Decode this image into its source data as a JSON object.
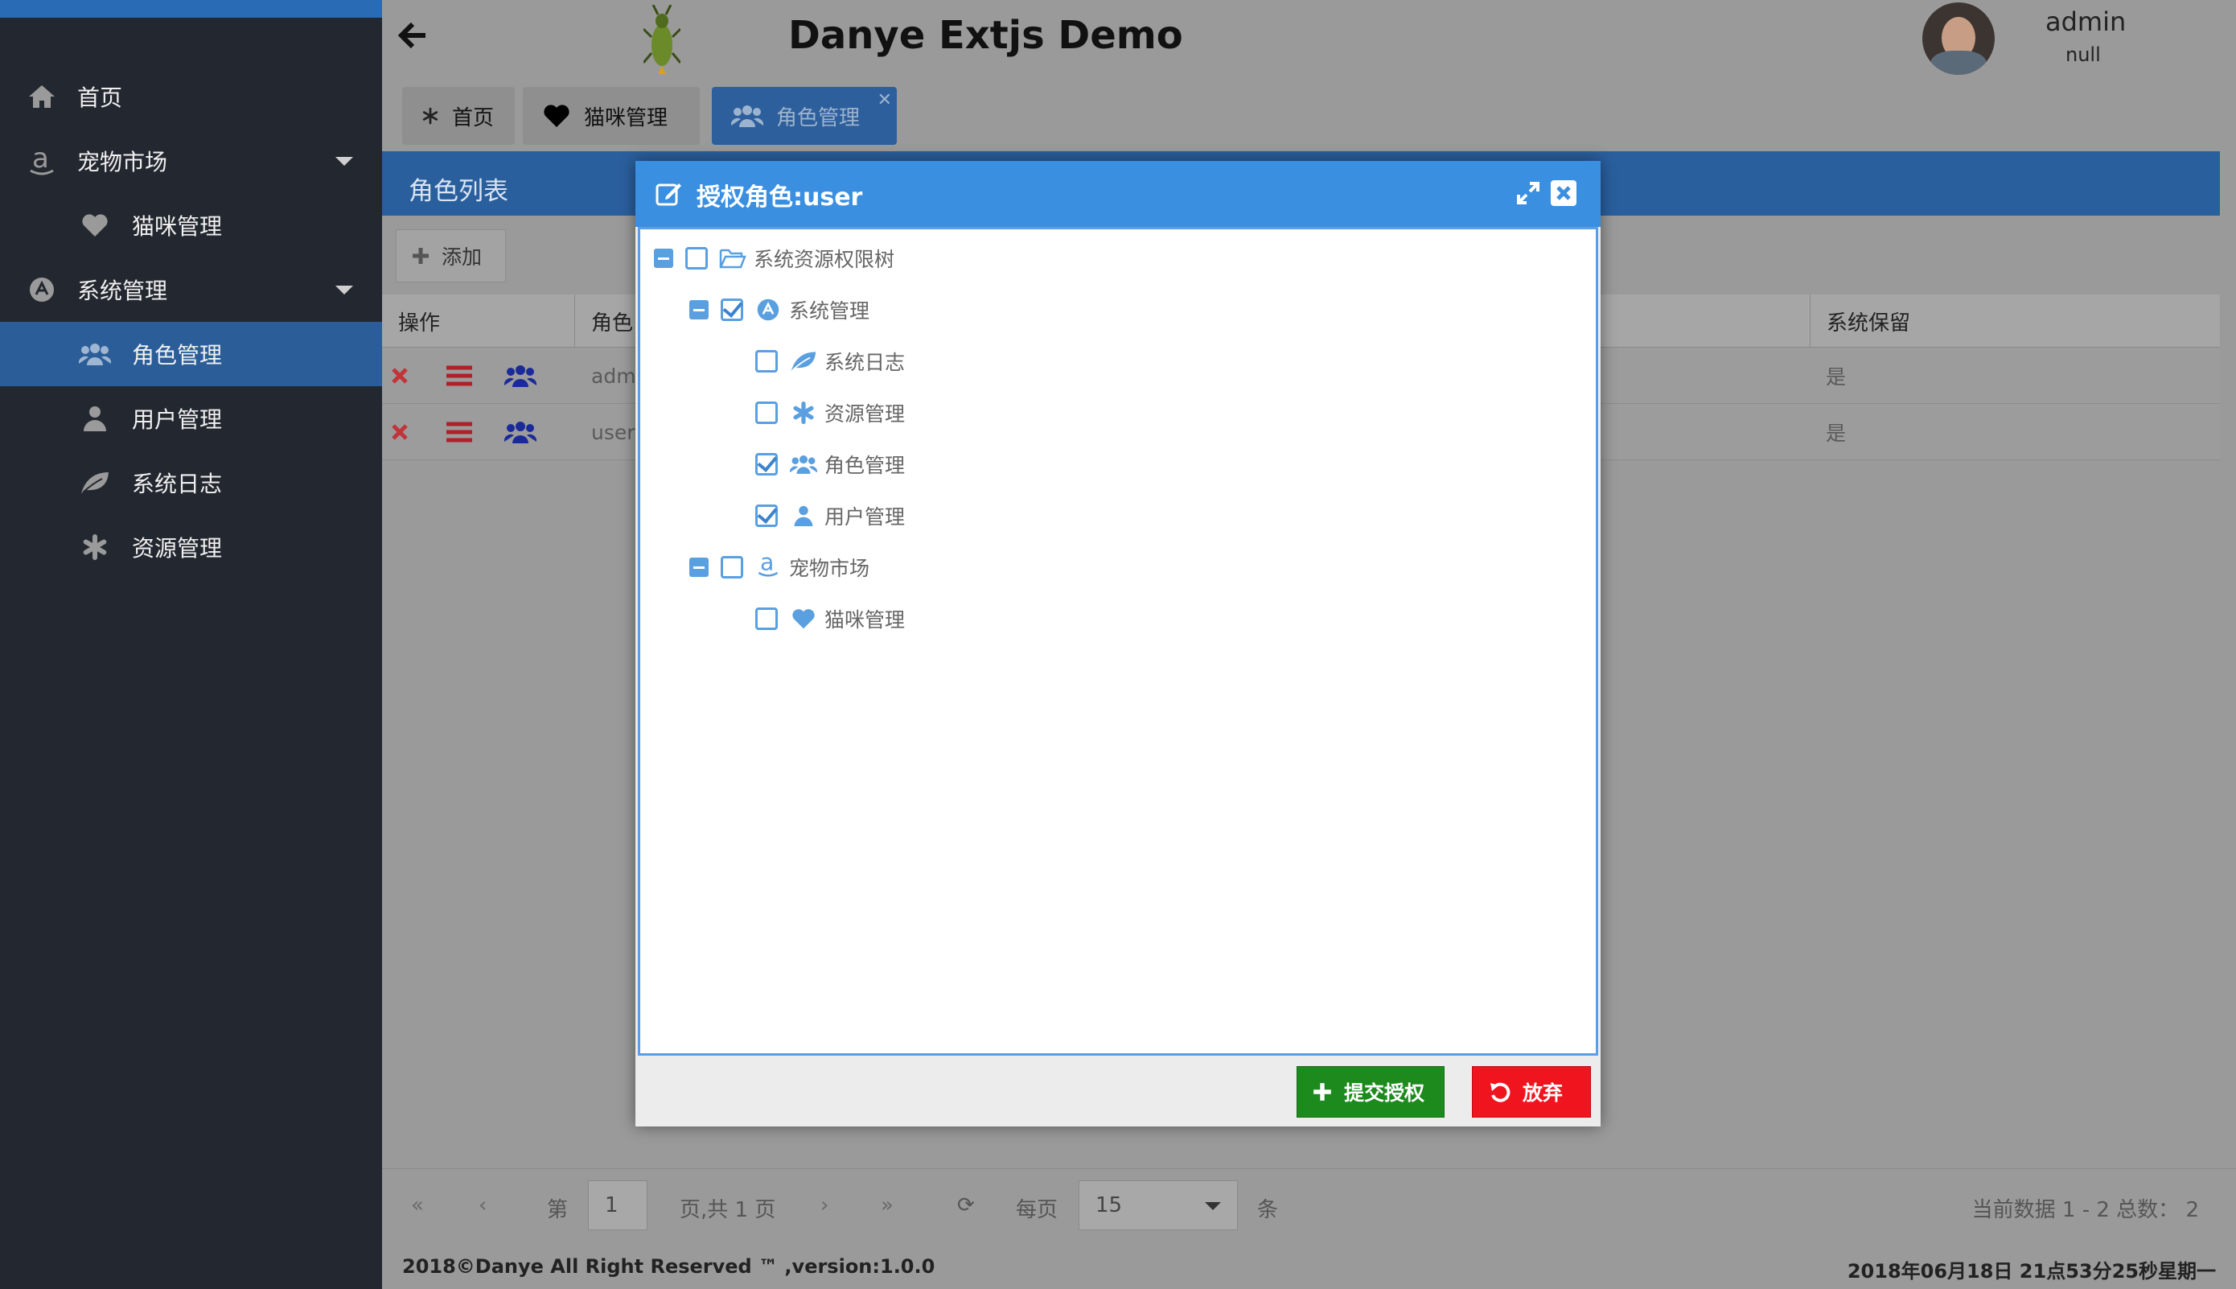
{
  "app": {
    "title": "Danye Extjs Demo",
    "user": {
      "name": "admin",
      "subtitle": "null"
    }
  },
  "sidebar": {
    "items": [
      {
        "label": "首页",
        "icon": "home-icon"
      },
      {
        "label": "宠物市场",
        "icon": "amazon-icon"
      },
      {
        "label": "猫咪管理",
        "icon": "heart-icon"
      },
      {
        "label": "系统管理",
        "icon": "system-icon"
      },
      {
        "label": "角色管理",
        "icon": "users-icon"
      },
      {
        "label": "用户管理",
        "icon": "user-icon"
      },
      {
        "label": "系统日志",
        "icon": "leaf-icon"
      },
      {
        "label": "资源管理",
        "icon": "asterisk-icon"
      }
    ]
  },
  "tabs": [
    {
      "label": "首页",
      "icon": "asterisk-icon"
    },
    {
      "label": "猫咪管理",
      "icon": "heart-icon"
    },
    {
      "label": "角色管理",
      "icon": "users-icon"
    }
  ],
  "panel": {
    "title": "角色列表",
    "add_label": "添加",
    "columns": {
      "actions": "操作",
      "role": "角色",
      "reserved": "系统保留"
    },
    "rows": [
      {
        "role": "adm",
        "reserved": "是"
      },
      {
        "role": "user",
        "reserved": "是"
      }
    ]
  },
  "pager": {
    "page_label": "第",
    "page_value": "1",
    "page_total": "页,共 1 页",
    "per_page_label": "每页",
    "per_page_value": "15",
    "unit": "条",
    "summary": "当前数据 1 - 2 总数： 2"
  },
  "footer": {
    "copyright": "2018©Danye All Right Reserved ™ ,version:1.0.0",
    "datetime": "2018年06月18日 21点53分25秒星期一"
  },
  "dialog": {
    "title": "授权角色:user",
    "tree": [
      {
        "label": "系统资源权限树",
        "icon": "folder-open-icon",
        "checked": false
      },
      {
        "label": "系统管理",
        "icon": "system-icon",
        "checked": true
      },
      {
        "label": "系统日志",
        "icon": "leaf-icon",
        "checked": false
      },
      {
        "label": "资源管理",
        "icon": "asterisk-icon",
        "checked": false
      },
      {
        "label": "角色管理",
        "icon": "users-icon",
        "checked": true
      },
      {
        "label": "用户管理",
        "icon": "user-icon",
        "checked": true
      },
      {
        "label": "宠物市场",
        "icon": "amazon-icon",
        "checked": false
      },
      {
        "label": "猫咪管理",
        "icon": "heart-icon",
        "checked": false
      }
    ],
    "submit_label": "提交授权",
    "cancel_label": "放弃"
  },
  "colors": {
    "sidebar_bg": "#232830",
    "accent_blue": "#3a8fe0",
    "panel_header": "#2a5f9e",
    "submit_green": "#1d8a1d",
    "cancel_red": "#f0141e"
  }
}
